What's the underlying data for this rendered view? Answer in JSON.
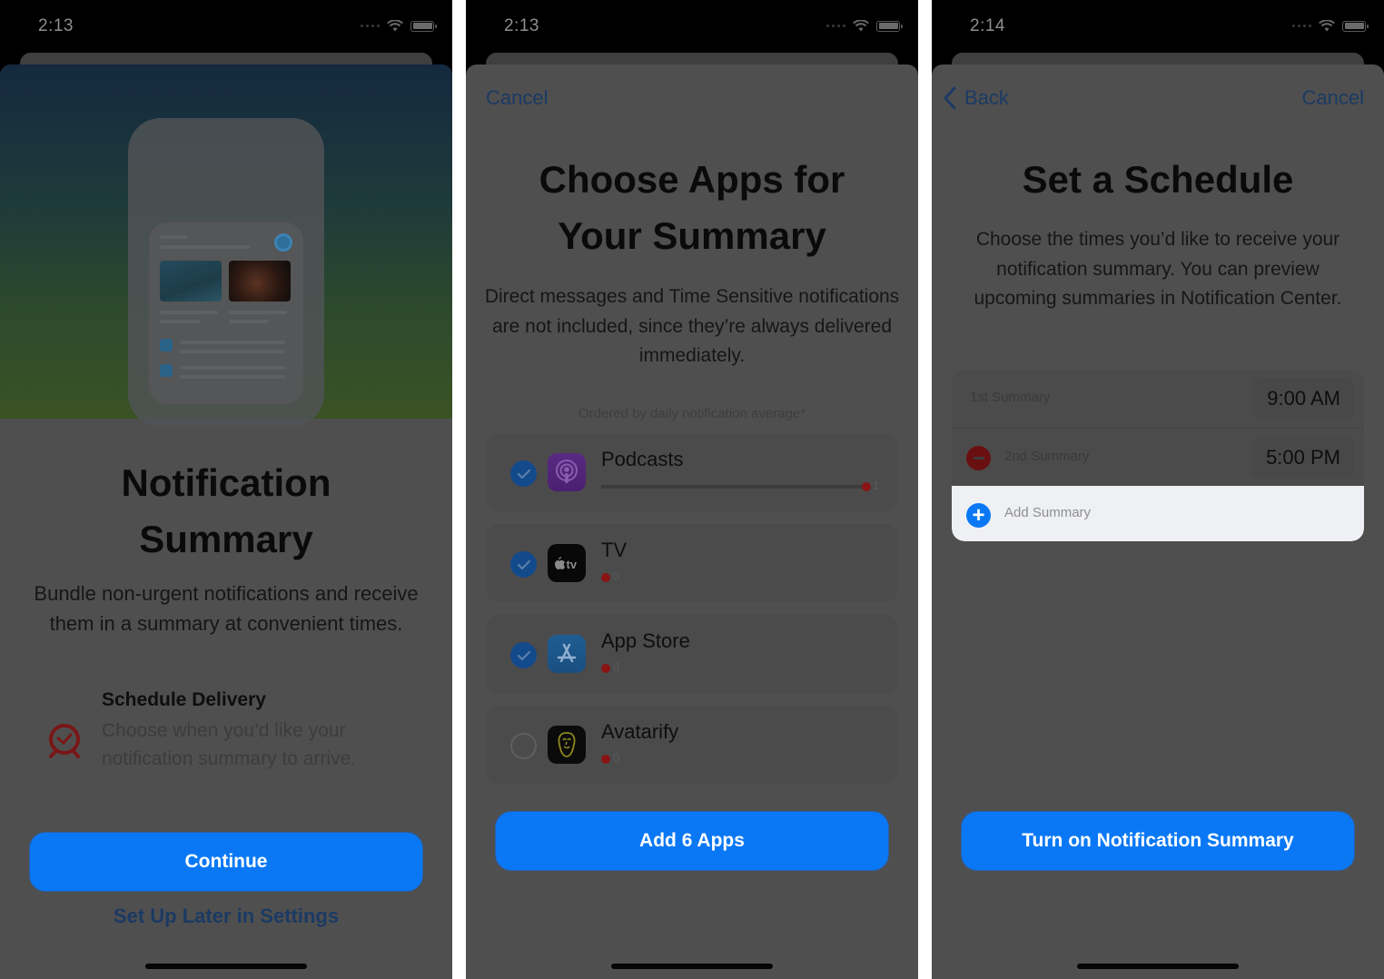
{
  "screens": [
    {
      "status_time": "2:13",
      "title": "Notification Summary",
      "description": "Bundle non-urgent notifications and receive them in a summary at convenient times.",
      "feature": {
        "icon": "alarm-clock-icon",
        "title": "Schedule Delivery",
        "description": "Choose when you’d like your notification summary to arrive."
      },
      "primary_button": "Continue",
      "secondary_link": "Set Up Later in Settings"
    },
    {
      "status_time": "2:13",
      "nav_cancel": "Cancel",
      "title": "Choose Apps for Your Summary",
      "description": "Direct messages and Time Sensitive notifications are not included, since they’re always delivered immediately.",
      "note": "Ordered by daily notification average*",
      "apps": [
        {
          "name": "Podcasts",
          "icon": "podcasts-icon",
          "checked": true,
          "count": "1",
          "avg_fraction": 1.0
        },
        {
          "name": "TV",
          "icon": "apple-tv-icon",
          "icon_text": "tv",
          "checked": true,
          "count": "0",
          "avg_fraction": 0
        },
        {
          "name": "App Store",
          "icon": "app-store-icon",
          "checked": true,
          "count": "0",
          "avg_fraction": 0
        },
        {
          "name": "Avatarify",
          "icon": "avatarify-icon",
          "checked": false,
          "count": "0",
          "avg_fraction": 0
        }
      ],
      "primary_button": "Add 6 Apps"
    },
    {
      "status_time": "2:14",
      "nav_back": "Back",
      "nav_cancel": "Cancel",
      "title": "Set a Schedule",
      "description": "Choose the times you’d like to receive your notification summary. You can preview upcoming summaries in Notification Center.",
      "summaries": [
        {
          "label": "1st Summary",
          "time": "9:00 AM",
          "removable": false
        },
        {
          "label": "2nd Summary",
          "time": "5:00 PM",
          "removable": true
        }
      ],
      "add_summary_label": "Add Summary",
      "primary_button": "Turn on Notification Summary"
    }
  ],
  "colors": {
    "accent": "#0a78f5",
    "destructive": "#6a1010",
    "overlay_bg": "#4f4f4f"
  }
}
